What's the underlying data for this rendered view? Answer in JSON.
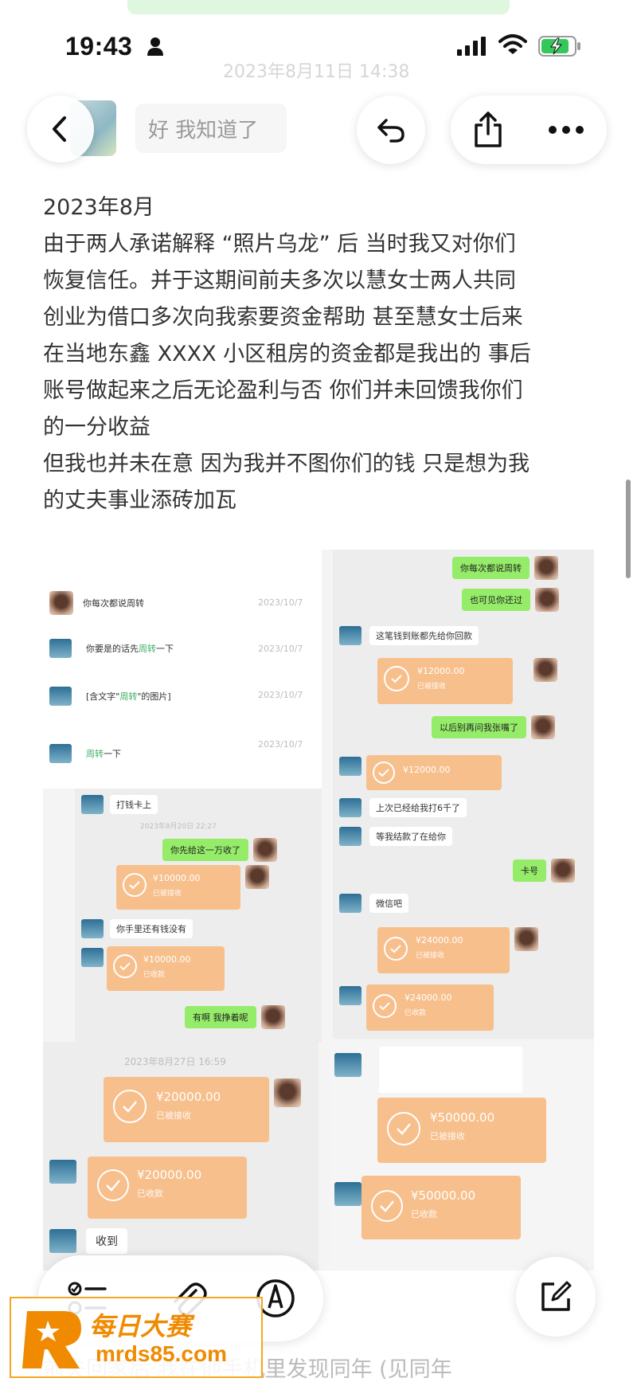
{
  "status_bar": {
    "time": "19:43"
  },
  "header": {
    "faded_timestamp": "2023年8月11日 14:38",
    "title": "好 我知道了"
  },
  "note": {
    "lines": [
      "2023年8月",
      "由于两人承诺解释 “照片乌龙” 后 当时我又对你们",
      "恢复信任。并于这期间前夫多次以慧女士两人共同",
      "创业为借口多次向我索要资金帮助 甚至慧女士后来",
      "在当地东鑫 XXXX 小区租房的资金都是我出的 事后",
      "账号做起来之后无论盈利与否 你们并未回馈我你们",
      "的一分收益",
      "但我也并未在意 因为我并不图你们的钱 只是想为我",
      "的丈夫事业添砖加瓦"
    ],
    "bottom_line": "前夫回家后 我在他手机里发现同年 (见同年"
  },
  "collage": {
    "left_top": {
      "msg1": "你每次都说周转",
      "msg1_hl": "周转",
      "ts1": "2023/10/7",
      "msg2a": "你要是",
      "msg2b": "的话先",
      "msg2_hl": "周转",
      "msg2c": "一下",
      "ts2": "2023/10/7",
      "msg3a": "[含文字\"",
      "msg3_hl": "周转",
      "msg3b": "\"的图片]",
      "ts3": "2023/10/7",
      "msg4_hl": "周转",
      "msg4b": "一下",
      "ts4": "2023/10/7"
    },
    "left_mid": {
      "msg1": "打钱卡上",
      "ts": "2023年8月20日 22:27",
      "msg2": "你先给这一万收了",
      "t1_amount": "¥10000.00",
      "t1_status": "已被接收",
      "msg3": "你手里还有钱没有",
      "t2_amount": "¥10000.00",
      "t2_status": "已收款",
      "msg4": "有啊 我挣着呢"
    },
    "left_bottom": {
      "ts": "2023年8月27日 16:59",
      "t1_amount": "¥20000.00",
      "t1_status": "已被接收",
      "t2_amount": "¥20000.00",
      "t2_status": "已收款",
      "msg": "收到"
    },
    "right_top": {
      "msg1": "你每次都说周转",
      "msg2": "也可见你还过",
      "msg3": "这笔钱到账都先给你回款",
      "t1_amount": "¥12000.00",
      "t1_status": "已被接收",
      "msg4": "以后别再问我张嘴了",
      "t2_amount": "¥12000.00",
      "msg5": "上次已经给我打6千了",
      "msg6": "等我结款了在给你",
      "msg7": "卡号",
      "msg8": "微信吧",
      "t3_amount": "¥24000.00",
      "t3_status": "已被接收",
      "t4_amount": "¥24000.00",
      "t4_status": "已收款"
    },
    "right_bottom": {
      "t1_amount": "¥50000.00",
      "t1_status": "已被接收",
      "t2_amount": "¥50000.00",
      "t2_status": "已收款"
    }
  },
  "watermark": {
    "name": "每日大赛",
    "url": "mrds85.com"
  }
}
